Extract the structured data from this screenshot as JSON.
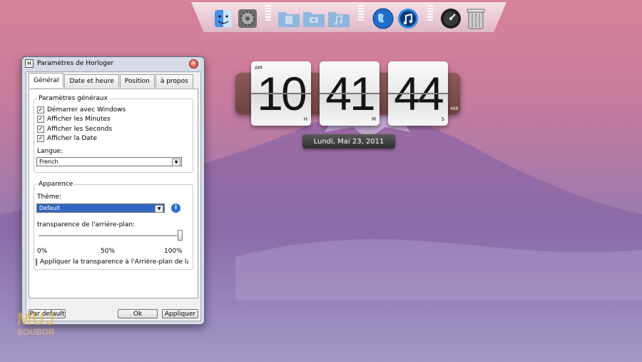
{
  "dock": {
    "items": [
      {
        "icon": "finder-icon"
      },
      {
        "icon": "system-preferences-icon"
      },
      {
        "icon": "documents-folder-icon"
      },
      {
        "icon": "pictures-folder-icon"
      },
      {
        "icon": "music-folder-icon"
      },
      {
        "icon": "globe-browser-icon"
      },
      {
        "icon": "itunes-icon"
      },
      {
        "icon": "dashboard-icon"
      },
      {
        "icon": "trash-icon"
      }
    ]
  },
  "clock": {
    "ampm": "AM",
    "hours": "10",
    "minutes": "41",
    "seconds": "44",
    "h_label": "H",
    "m_label": "M",
    "s_label": "S",
    "extra": "466",
    "date": "Lundi, Mai 23, 2011"
  },
  "dialog": {
    "title": "Paramètres de Horloger",
    "title_icon": "H",
    "tabs": [
      "Général",
      "Date et heure",
      "Position",
      "à propos"
    ],
    "active_tab": "Général",
    "general": {
      "legend": "Paramètres généraux",
      "options": [
        {
          "label": "Démarrer avec Windows",
          "checked": true
        },
        {
          "label": "Afficher les Minutes",
          "checked": true
        },
        {
          "label": "Afficher les Seconds",
          "checked": true
        },
        {
          "label": "Afficher la Date",
          "checked": true
        }
      ],
      "language_label": "Langue:",
      "language_value": "French"
    },
    "appearance": {
      "legend": "Apparence",
      "theme_label": "Théme:",
      "theme_value": "Default",
      "transparency_label": "transparence de l'arriére-plan:",
      "transparency_level": 1.0,
      "scale_min": "0%",
      "scale_mid": "50%",
      "scale_max": "100%",
      "apply_bg_label": "Appliquer la transparence à l'Arriére-plan de la dat",
      "apply_bg_checked": false
    },
    "buttons": {
      "default": "Par default",
      "ok": "Ok",
      "apply": "Appliquer"
    }
  },
  "watermark": {
    "line1": "MUJ",
    "line2": "SOUBOR"
  }
}
